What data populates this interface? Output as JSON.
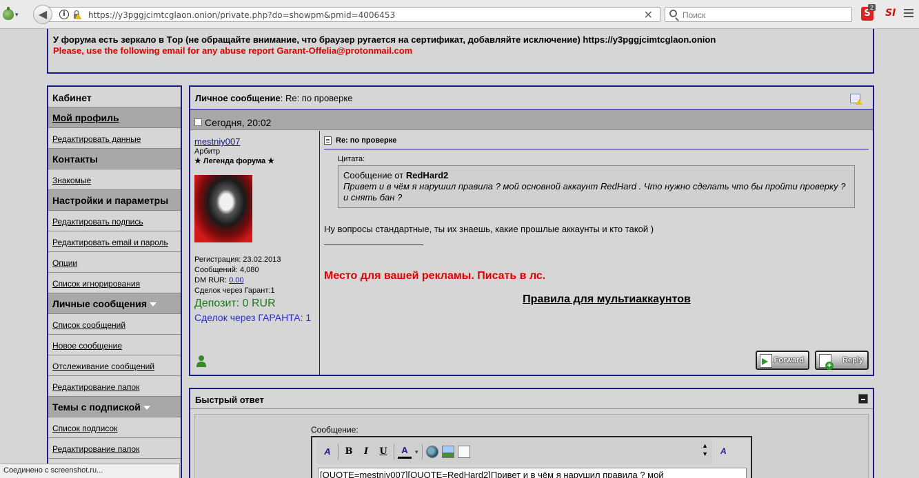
{
  "browser": {
    "url": "https://y3pggjcimtcglaon.onion/private.php?do=showpm&pmid=4006453",
    "search_placeholder": "Поиск",
    "ext_badge": "2"
  },
  "notice": {
    "line1": "У форума есть зеркало в Tор (не обращайте внимание, что браузер ругается на сертификат, добавляйте исключение) https://y3pggjcimtcglaon.onion",
    "line2": "Please, use the following email for any abuse report Garant-Offelia@protonmail.com"
  },
  "sidebar": {
    "header": "Кабинет",
    "items": [
      {
        "label": "Мой профиль",
        "kind": "section-link"
      },
      {
        "label": "Редактировать данные",
        "kind": "item"
      },
      {
        "label": "Контакты",
        "kind": "section"
      },
      {
        "label": "Знакомые",
        "kind": "item"
      },
      {
        "label": "Настройки и параметры",
        "kind": "section"
      },
      {
        "label": "Редактировать подпись",
        "kind": "item"
      },
      {
        "label": "Редактировать email и пароль",
        "kind": "item"
      },
      {
        "label": "Опции",
        "kind": "item"
      },
      {
        "label": "Список игнорирования",
        "kind": "item"
      },
      {
        "label": "Личные сообщения",
        "kind": "section-dd"
      },
      {
        "label": "Список сообщений",
        "kind": "item"
      },
      {
        "label": "Новое сообщение",
        "kind": "item"
      },
      {
        "label": "Отслеживание сообщений",
        "kind": "item"
      },
      {
        "label": "Редактирование папок",
        "kind": "item"
      },
      {
        "label": "Темы с подпиской",
        "kind": "section-dd"
      },
      {
        "label": "Список подписок",
        "kind": "item"
      },
      {
        "label": "Редактирование папок",
        "kind": "item"
      }
    ]
  },
  "pm": {
    "title_label": "Личное сообщение",
    "title_subject": "Re: по проверке",
    "date": "Сегодня, 20:02",
    "user": {
      "name": "mestniy007",
      "role": "Арбитр",
      "legend": "★ Легенда форума ★",
      "registration": "Регистрация: 23.02.2013",
      "posts": "Сообщений: 4,080",
      "dm_label": "DM RUR: ",
      "dm_value": "0.00",
      "deals_small": "Сделок через Гарант:1",
      "deposit": "Депозит: 0 RUR",
      "deals": "Сделок через ГАРАНТА: 1"
    },
    "message": {
      "subject": "Re: по проверке",
      "quote_label": "Цитата:",
      "quote_from": "Сообщение от ",
      "quote_author": "RedHard2",
      "quote_text": "Привет и в чём я нарушил правила ? мой основной аккаунт RedHard . Что нужно сделать что бы пройти проверку ? и снять бан ?",
      "body": "Ну вопросы стандартные, ты их знаешь, какие прошлые аккаунты и кто такой )",
      "ad": "Место для вашей рекламы. Писать в лс.",
      "rules_link": "Правила для мультиаккаунтов"
    },
    "buttons": {
      "forward": "Forward",
      "reply": "Reply"
    }
  },
  "quick_reply": {
    "title": "Быстрый ответ",
    "label": "Сообщение:",
    "toolbar": {
      "bold": "B",
      "italic": "I",
      "underline": "U",
      "color": "A"
    },
    "text": "[QUOTE=mestniy007][QUOTE=RedHard2]Привет  и в чём я нарушил  правила ?  мой"
  },
  "status_bar": "Соединено с screenshot.ru..."
}
